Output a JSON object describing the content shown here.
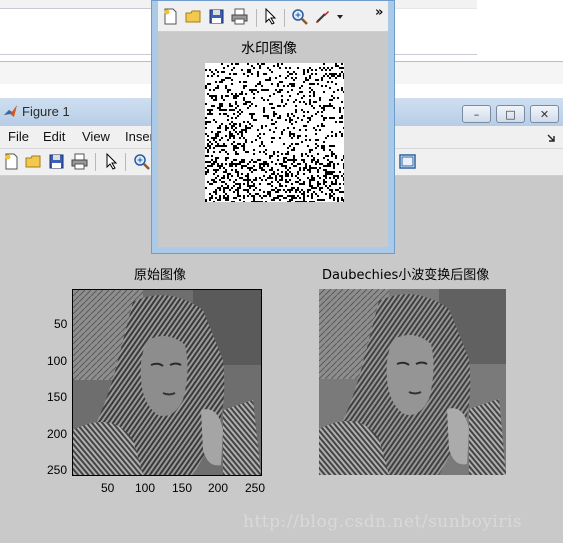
{
  "figure_window": {
    "title": "Figure 1",
    "menu": [
      "File",
      "Edit",
      "View",
      "Inser"
    ],
    "controls": {
      "minimize": "–",
      "maximize": "□",
      "close": "✕"
    }
  },
  "watermark_window": {
    "title": "水印图像",
    "toolbar_overflow": "»"
  },
  "plots": {
    "original": {
      "title": "原始图像",
      "y_ticks": [
        "50",
        "100",
        "150",
        "200",
        "250"
      ],
      "x_ticks": [
        "50",
        "100",
        "150",
        "200",
        "250"
      ]
    },
    "transformed": {
      "title": "Daubechies小波变换后图像"
    }
  },
  "page_watermark": "http://blog.csdn.net/sunboyiris",
  "colors": {
    "figure_bg": "#c9c9c9",
    "title_bar": "#b7cde6",
    "window_frame": "#a9cbe8"
  }
}
